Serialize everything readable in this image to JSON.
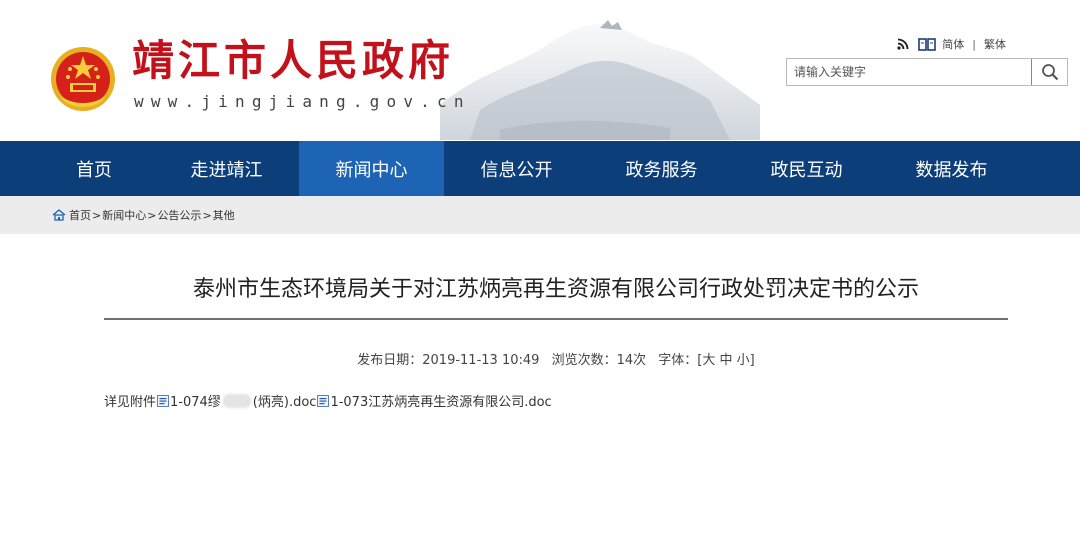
{
  "site": {
    "title": "靖江市人民政府",
    "url": "www.jingjiang.gov.cn",
    "lang_simplified": "简体",
    "lang_separator": "|",
    "lang_traditional": "繁体"
  },
  "search": {
    "placeholder": "请输入关键字"
  },
  "nav": {
    "items": [
      {
        "label": "首页"
      },
      {
        "label": "走进靖江"
      },
      {
        "label": "新闻中心"
      },
      {
        "label": "信息公开"
      },
      {
        "label": "政务服务"
      },
      {
        "label": "政民互动"
      },
      {
        "label": "数据发布"
      }
    ]
  },
  "breadcrumb": {
    "items": [
      "首页",
      "新闻中心",
      "公告公示",
      "其他"
    ],
    "separator": ">"
  },
  "article": {
    "title": "泰州市生态环境局关于对江苏炳亮再生资源有限公司行政处罚决定书的公示",
    "publish_label": "发布日期：",
    "publish_date": "2019-11-13 10:49",
    "views_label": "浏览次数：",
    "views_value": "14次",
    "font_label": "字体：[",
    "font_large": "大",
    "font_medium": "中",
    "font_small": "小",
    "font_close": "]",
    "content_prefix": "详见附件",
    "attachment1_prefix": "1-074缪",
    "attachment1_suffix": "(炳亮).doc",
    "attachment2": "1-073江苏炳亮再生资源有限公司.doc"
  },
  "icons": {
    "rss": "rss-icon",
    "book": "book-icon",
    "search": "search-icon",
    "home": "home-icon",
    "doc": "doc-icon",
    "emblem": "national-emblem-icon"
  },
  "colors": {
    "title_red": "#c2111a",
    "nav_bg": "#0c3e7a",
    "nav_active": "#1d64b4",
    "breadcrumb_bg": "#ececec"
  }
}
